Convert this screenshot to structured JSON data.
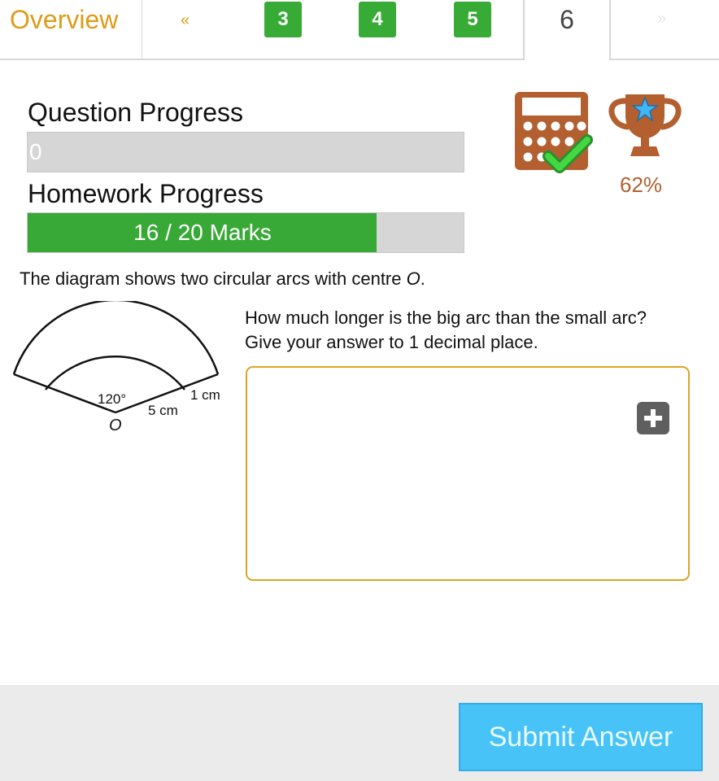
{
  "nav": {
    "overview_label": "Overview",
    "prev_label": "«",
    "next_label": "»",
    "questions": [
      {
        "label": "3"
      },
      {
        "label": "4"
      },
      {
        "label": "5"
      },
      {
        "label": "6"
      }
    ]
  },
  "progress": {
    "question_label": "Question Progress",
    "question_value_text": "0",
    "question_fraction": 0,
    "homework_label": "Homework Progress",
    "homework_value_text": "16 / 20 Marks",
    "homework_fraction": 0.8
  },
  "status": {
    "trophy_percent": "62%"
  },
  "question": {
    "intro_prefix": "The diagram shows two circular arcs with centre ",
    "intro_centre": "O",
    "intro_suffix": ".",
    "prompt_line1": "How much longer is the big arc than the small arc?",
    "prompt_line2": "Give your answer to 1 decimal place."
  },
  "diagram": {
    "angle_label": "120°",
    "inner_radius_label": "5 cm",
    "gap_label": "1 cm",
    "centre_label": "O"
  },
  "footer": {
    "submit_label": "Submit Answer"
  },
  "colors": {
    "accent": "#dd9b17",
    "success": "#37ab36",
    "submit": "#48c3f7",
    "icon_brown": "#b35f2f"
  }
}
